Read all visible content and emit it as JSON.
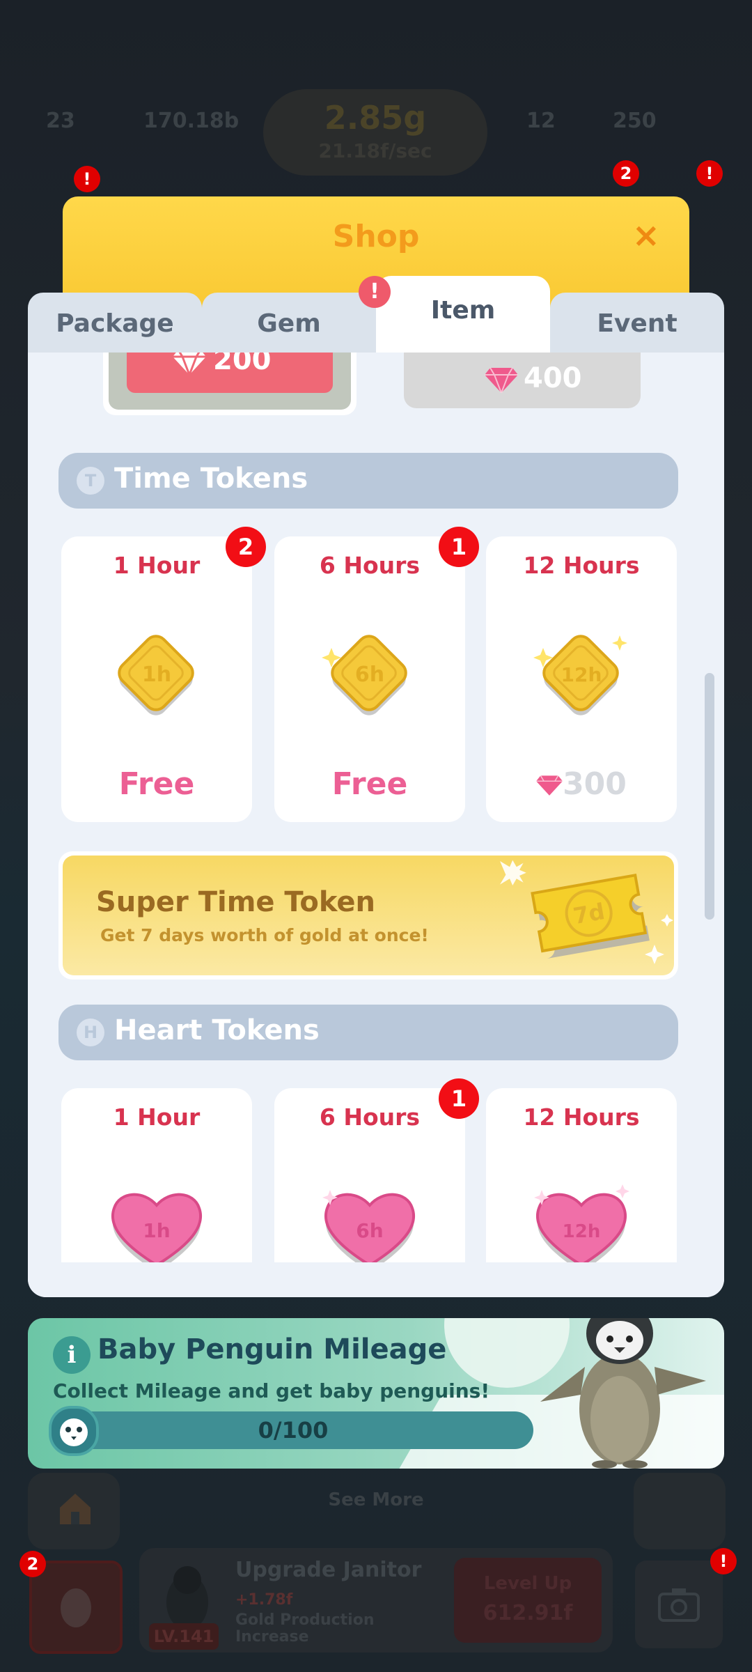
{
  "hud": {
    "stat1": "23",
    "stat2": "170.18b",
    "gold": "2.85g",
    "gold_rate": "21.18f/sec",
    "stat3": "12",
    "gems": "250"
  },
  "side_badges": {
    "left": "!",
    "a": "2",
    "b": "!"
  },
  "shop": {
    "title": "Shop",
    "close": "×",
    "tabs": [
      "Package",
      "Gem",
      "Item",
      "Event"
    ],
    "active_tab": "Item",
    "tab_badge": "!",
    "top_prices": [
      "200",
      "400"
    ]
  },
  "time_tokens": {
    "heading": "Time Tokens",
    "heading_icon": "T",
    "cards": [
      {
        "label": "1 Hour",
        "coin": "1h",
        "price": "Free",
        "badge": "2"
      },
      {
        "label": "6 Hours",
        "coin": "6h",
        "price": "Free",
        "badge": "1"
      },
      {
        "label": "12 Hours",
        "coin": "12h",
        "price": "300",
        "badge": ""
      }
    ]
  },
  "super_token": {
    "title": "Super Time Token",
    "subtitle": "Get 7 days worth of gold at once!",
    "ticket": "7d"
  },
  "heart_tokens": {
    "heading": "Heart Tokens",
    "heading_icon": "H",
    "cards": [
      {
        "label": "1 Hour",
        "coin": "1h",
        "badge": ""
      },
      {
        "label": "6 Hours",
        "coin": "6h",
        "badge": "1"
      },
      {
        "label": "12 Hours",
        "coin": "12h",
        "badge": ""
      }
    ]
  },
  "mileage": {
    "info_icon": "i",
    "title": "Baby Penguin Mileage",
    "subtitle": "Collect Mileage and get baby penguins!",
    "progress": "0/100",
    "progress_fraction": 0
  },
  "bottom": {
    "see_more": "See More",
    "upgrade_title": "Upgrade Janitor",
    "level": "LV.141",
    "bonus": "+1.78f",
    "bonus_desc": "Gold Production Increase",
    "level_up": "Level Up",
    "level_up_cost": "612.91f",
    "egg_badge": "2",
    "camera_badge": "!"
  },
  "colors": {
    "accent_yellow": "#f9c832",
    "title_orange": "#f39b1c",
    "label_red": "#d8334f",
    "price_pink": "#ec5f94",
    "section_blue": "#b9c8da",
    "mileage_green": "#6cc6a6"
  }
}
